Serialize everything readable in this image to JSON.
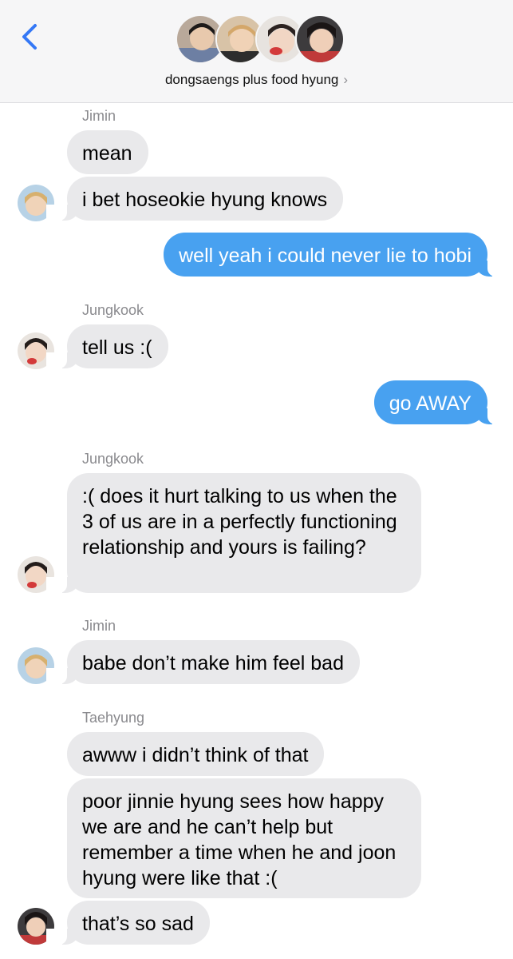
{
  "header": {
    "title": "dongsaengs plus food hyung",
    "chevron": "›",
    "back_icon": "chevron-left-icon",
    "accent_color": "#3478f6",
    "avatars": [
      "member-photo-1",
      "member-photo-2",
      "member-photo-3",
      "member-photo-4"
    ]
  },
  "colors": {
    "incoming_bubble": "#e9e9eb",
    "outgoing_bubble": "#48a1f0"
  },
  "messages": [
    {
      "sender": "Jimin",
      "text": "mean",
      "direction": "incoming"
    },
    {
      "text": "i bet hoseokie hyung knows",
      "direction": "incoming"
    },
    {
      "text": "well yeah i could never lie to hobi",
      "direction": "outgoing"
    },
    {
      "sender": "Jungkook",
      "text": "tell us :(",
      "direction": "incoming"
    },
    {
      "text": "go AWAY",
      "direction": "outgoing"
    },
    {
      "sender": "Jungkook",
      "text": ":( does it hurt talking to us when the 3 of us are in a perfectly functioning relationship and yours is failing?",
      "direction": "incoming"
    },
    {
      "sender": "Jimin",
      "text": "babe don’t make him feel bad",
      "direction": "incoming"
    },
    {
      "sender": "Taehyung",
      "text": "awww i didn’t think of that",
      "direction": "incoming"
    },
    {
      "text": "poor jinnie hyung sees how happy we are and he can’t help but remember a time when he and joon hyung were like that :(",
      "direction": "incoming"
    },
    {
      "text": "that’s so sad",
      "direction": "incoming"
    }
  ]
}
